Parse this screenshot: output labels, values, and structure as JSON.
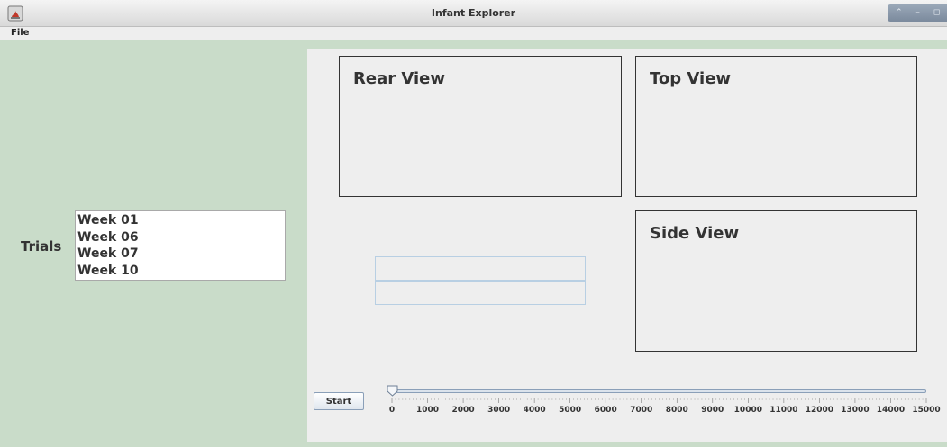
{
  "window": {
    "title": "Infant Explorer",
    "controls": "⌃ – ◻ ✕"
  },
  "menu": {
    "file_label": "File"
  },
  "trials": {
    "label": "Trials",
    "items": [
      "Week 01",
      "Week 06",
      "Week 07",
      "Week 10"
    ]
  },
  "views": {
    "rear": "Rear View",
    "top": "Top View",
    "side": "Side View"
  },
  "controls": {
    "start_label": "Start",
    "slider": {
      "min": 0,
      "max": 15000,
      "value": 0,
      "tick_labels": [
        "0",
        "1000",
        "2000",
        "3000",
        "4000",
        "5000",
        "6000",
        "7000",
        "8000",
        "9000",
        "10000",
        "11000",
        "12000",
        "13000",
        "14000",
        "15000"
      ]
    }
  },
  "colors": {
    "panel_bg": "#c9dcc9",
    "main_bg": "#eeeeee",
    "border": "#333333"
  }
}
